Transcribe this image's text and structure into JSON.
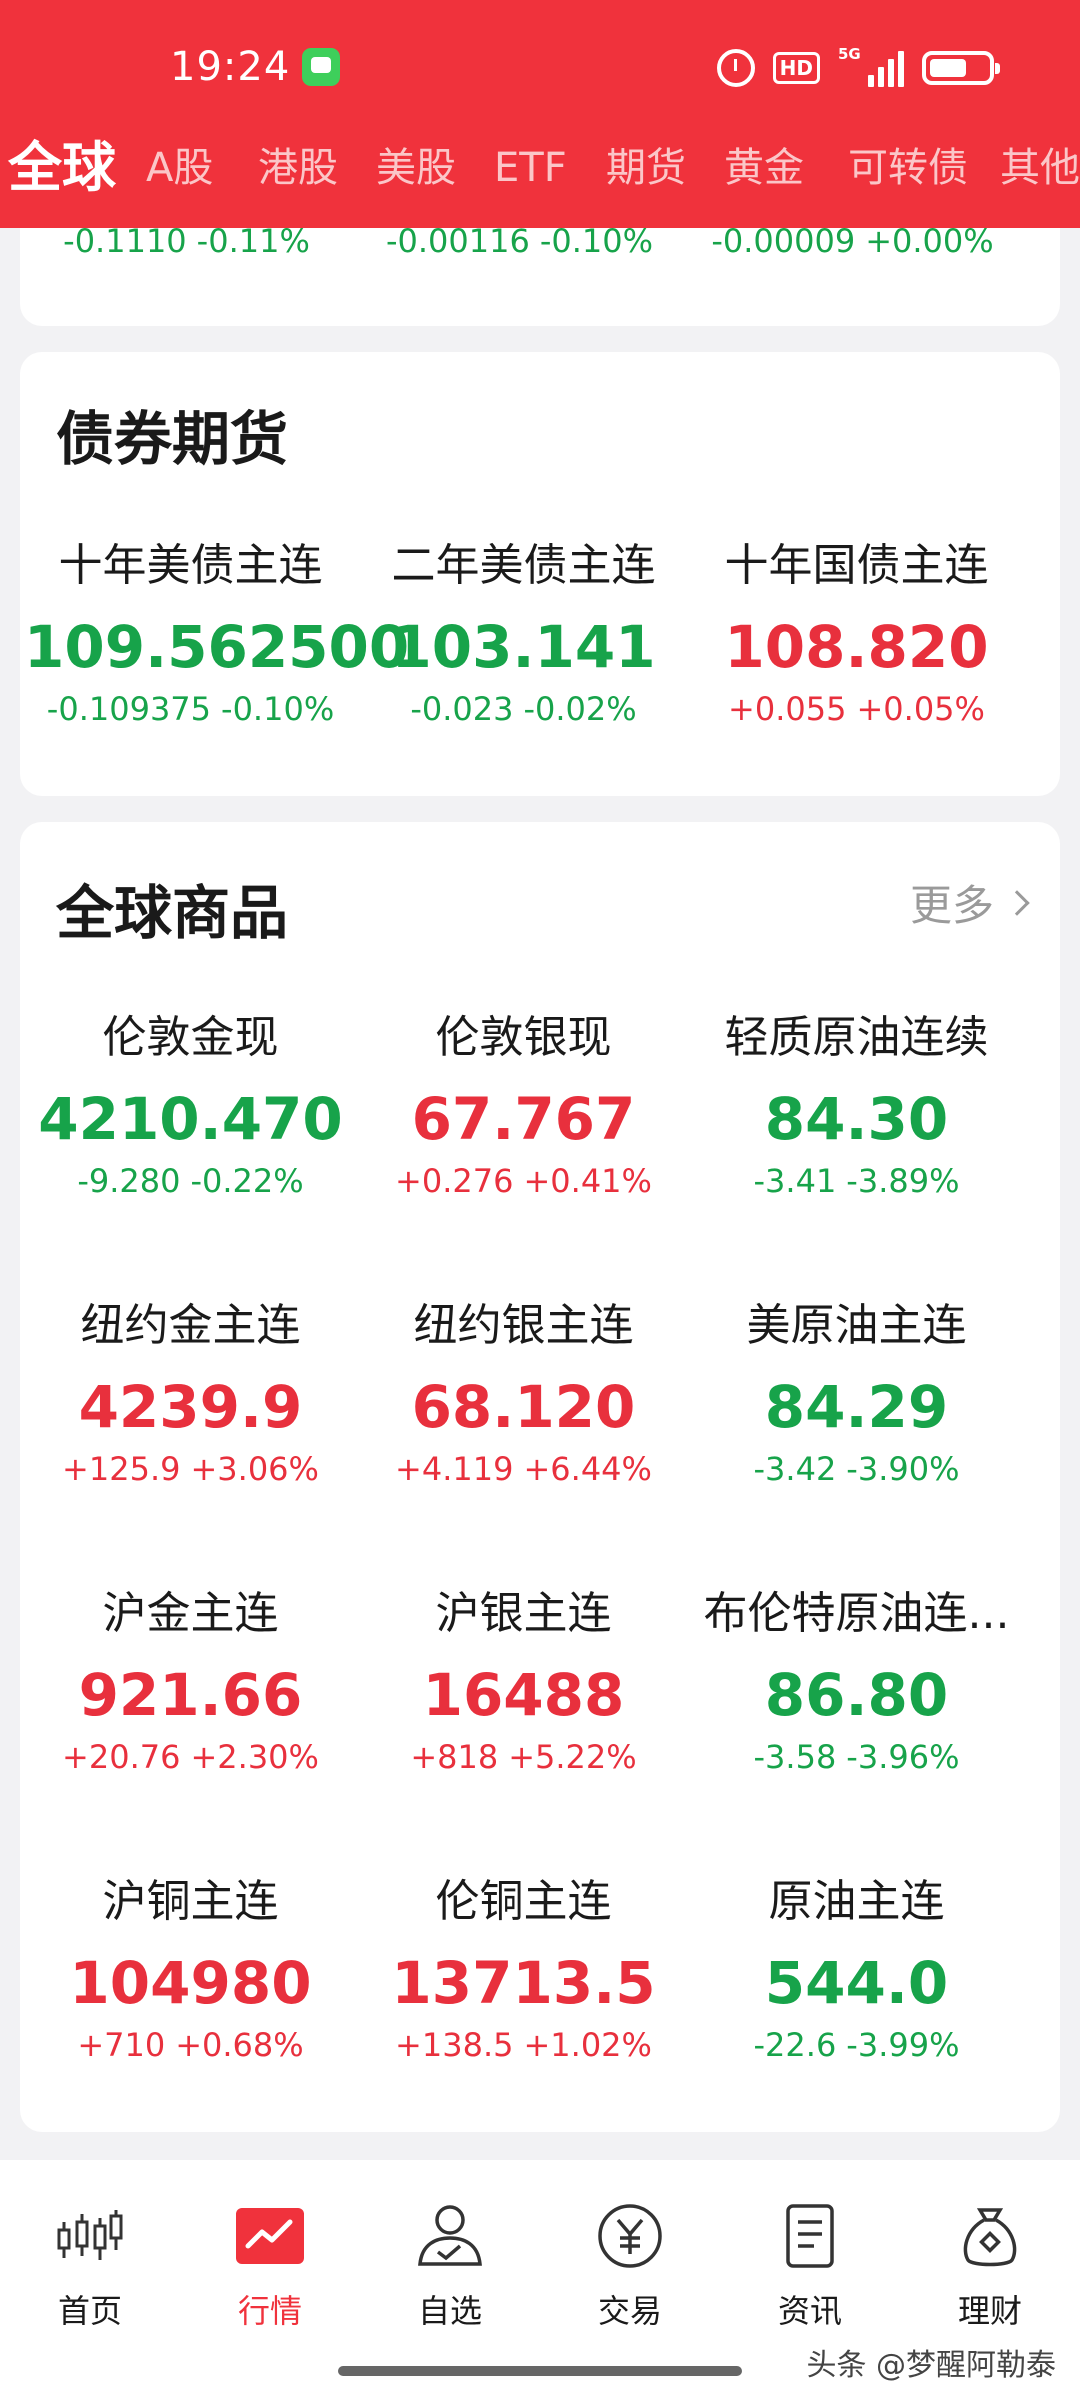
{
  "status": {
    "time": "19:24",
    "hd": "HD",
    "network": "5G"
  },
  "tabs": [
    "全球",
    "A股",
    "港股",
    "美股",
    "ETF",
    "期货",
    "黄金",
    "可转债",
    "其他"
  ],
  "top_strip": [
    {
      "change": "-0.1110",
      "percent": "-0.11%",
      "dir": "down"
    },
    {
      "change": "-0.00116",
      "percent": "-0.10%",
      "dir": "down"
    },
    {
      "change": "-0.00009",
      "percent": "+0.00%",
      "dir": "down"
    }
  ],
  "bond_futures": {
    "title": "债券期货",
    "items": [
      {
        "name": "十年美债主连",
        "price": "109.562500",
        "change": "-0.109375",
        "percent": "-0.10%",
        "dir": "down"
      },
      {
        "name": "二年美债主连",
        "price": "103.141",
        "change": "-0.023",
        "percent": "-0.02%",
        "dir": "down"
      },
      {
        "name": "十年国债主连",
        "price": "108.820",
        "change": "+0.055",
        "percent": "+0.05%",
        "dir": "up"
      }
    ]
  },
  "global_commodities": {
    "title": "全球商品",
    "more": "更多",
    "items": [
      {
        "name": "伦敦金现",
        "price": "4210.470",
        "change": "-9.280",
        "percent": "-0.22%",
        "dir": "down"
      },
      {
        "name": "伦敦银现",
        "price": "67.767",
        "change": "+0.276",
        "percent": "+0.41%",
        "dir": "up"
      },
      {
        "name": "轻质原油连续",
        "price": "84.30",
        "change": "-3.41",
        "percent": "-3.89%",
        "dir": "down"
      },
      {
        "name": "纽约金主连",
        "price": "4239.9",
        "change": "+125.9",
        "percent": "+3.06%",
        "dir": "up"
      },
      {
        "name": "纽约银主连",
        "price": "68.120",
        "change": "+4.119",
        "percent": "+6.44%",
        "dir": "up"
      },
      {
        "name": "美原油主连",
        "price": "84.29",
        "change": "-3.42",
        "percent": "-3.90%",
        "dir": "down"
      },
      {
        "name": "沪金主连",
        "price": "921.66",
        "change": "+20.76",
        "percent": "+2.30%",
        "dir": "up"
      },
      {
        "name": "沪银主连",
        "price": "16488",
        "change": "+818",
        "percent": "+5.22%",
        "dir": "up"
      },
      {
        "name": "布伦特原油连...",
        "price": "86.80",
        "change": "-3.58",
        "percent": "-3.96%",
        "dir": "down"
      },
      {
        "name": "沪铜主连",
        "price": "104980",
        "change": "+710",
        "percent": "+0.68%",
        "dir": "up"
      },
      {
        "name": "伦铜主连",
        "price": "13713.5",
        "change": "+138.5",
        "percent": "+1.02%",
        "dir": "up"
      },
      {
        "name": "原油主连",
        "price": "544.0",
        "change": "-22.6",
        "percent": "-3.99%",
        "dir": "down"
      }
    ]
  },
  "bottom_nav": [
    {
      "label": "首页",
      "icon": "candlestick-icon",
      "active": false
    },
    {
      "label": "行情",
      "icon": "market-chart-icon",
      "active": true
    },
    {
      "label": "自选",
      "icon": "user-check-icon",
      "active": false
    },
    {
      "label": "交易",
      "icon": "yen-circle-icon",
      "active": false
    },
    {
      "label": "资讯",
      "icon": "document-icon",
      "active": false
    },
    {
      "label": "理财",
      "icon": "money-bag-icon",
      "active": false
    }
  ],
  "watermark": "头条 @梦醒阿勒泰",
  "colors": {
    "brand_red": "#f0323c",
    "up": "#e8303d",
    "down": "#17a34a"
  }
}
